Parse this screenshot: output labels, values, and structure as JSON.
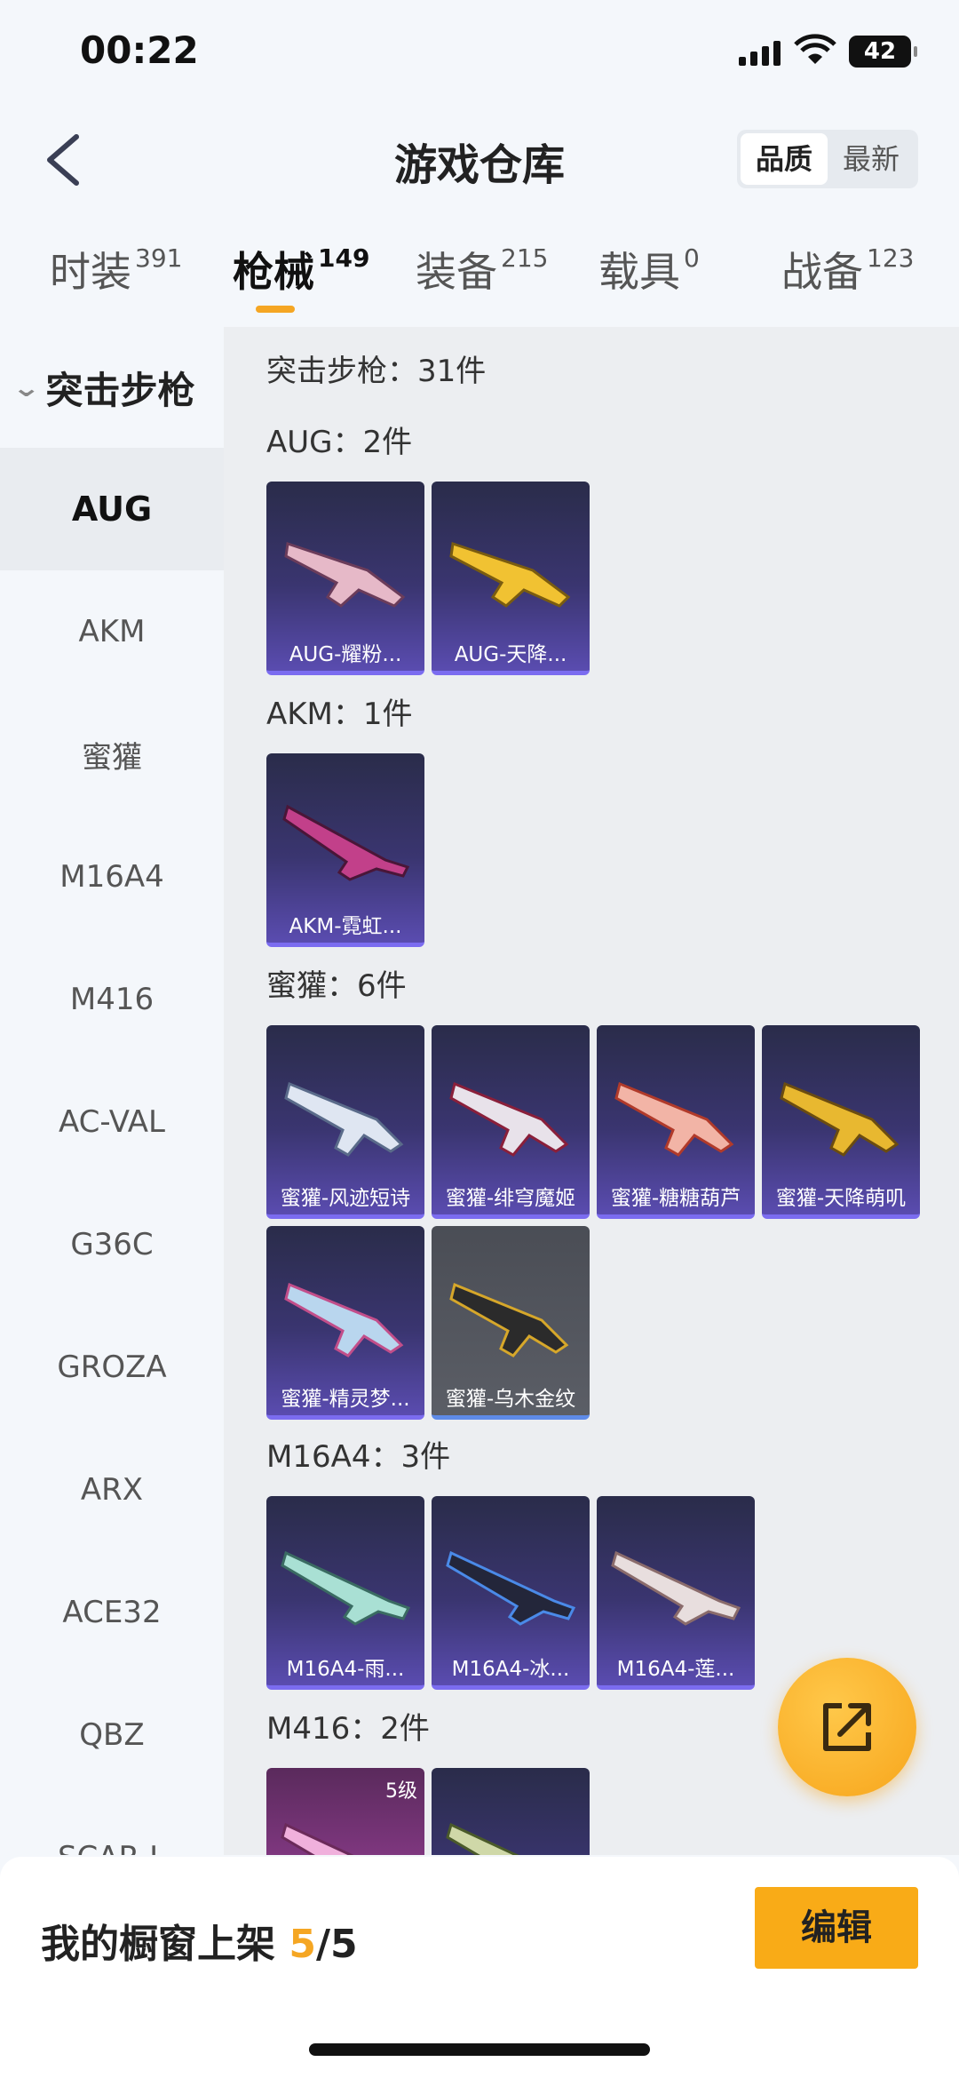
{
  "status": {
    "time": "00:22",
    "battery": "42"
  },
  "header": {
    "title": "游戏仓库",
    "sort": [
      "品质",
      "最新"
    ],
    "sort_active": 0
  },
  "tabs": [
    {
      "label": "时装",
      "count": "391"
    },
    {
      "label": "枪械",
      "count": "149"
    },
    {
      "label": "装备",
      "count": "215"
    },
    {
      "label": "载具",
      "count": "0"
    },
    {
      "label": "战备",
      "count": "123"
    }
  ],
  "sidebar": {
    "group": "突击步枪",
    "items": [
      "AUG",
      "AKM",
      "蜜獾",
      "M16A4",
      "M416",
      "AC-VAL",
      "G36C",
      "GROZA",
      "ARX",
      "ACE32",
      "QBZ",
      "SCAR-L"
    ]
  },
  "content": {
    "total": "突击步枪：31件",
    "sections": [
      {
        "title": "AUG：2件",
        "items": [
          "AUG-耀粉...",
          "AUG-天降..."
        ]
      },
      {
        "title": "AKM：1件",
        "items": [
          "AKM-霓虹..."
        ]
      },
      {
        "title": "蜜獾：6件",
        "items": [
          "蜜獾-风迹短诗",
          "蜜獾-绯穹魔姬",
          "蜜獾-糖糖葫芦",
          "蜜獾-天降萌叽",
          "蜜獾-精灵梦...",
          "蜜獾-乌木金纹"
        ]
      },
      {
        "title": "M16A4：3件",
        "items": [
          "M16A4-雨...",
          "M16A4-冰...",
          "M16A4-莲..."
        ]
      },
      {
        "title": "M416：2件",
        "items": [
          "",
          ""
        ],
        "level": "5级"
      }
    ]
  },
  "bottom": {
    "label": "我的橱窗上架 ",
    "count": "5",
    "total": "/5",
    "edit": "编辑"
  },
  "colors": {
    "accent": "#f5a623",
    "card_purple": "#3a3570",
    "card_grey": "#5b5e66"
  },
  "icons": {
    "back": "back-arrow-icon",
    "fab": "share-export-icon"
  }
}
